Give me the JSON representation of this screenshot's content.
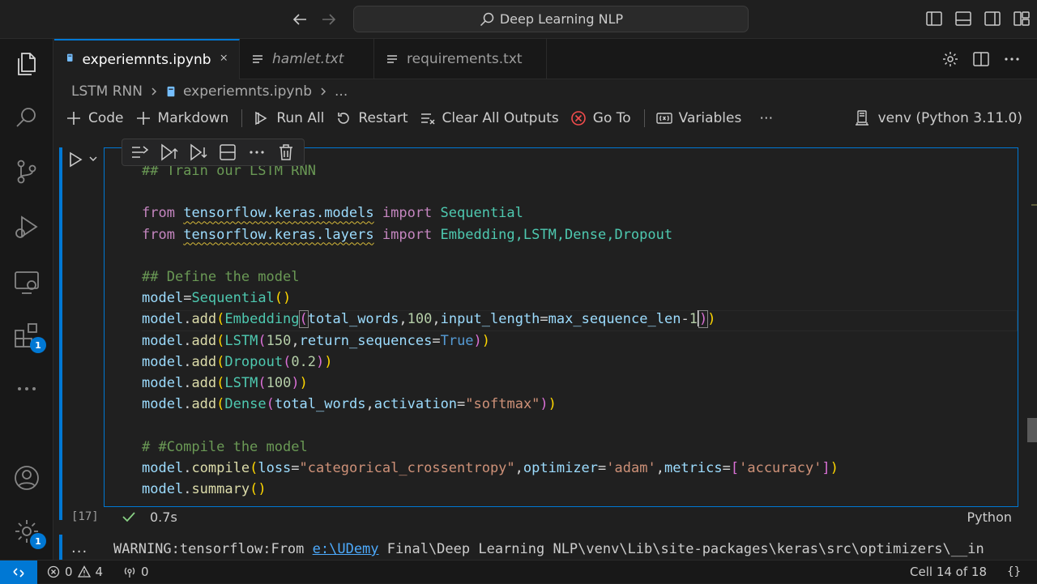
{
  "title": {
    "search_text": "Deep Learning NLP"
  },
  "tabs": [
    {
      "label": "experiemnts.ipynb",
      "icon": "notebook-icon",
      "active": true
    },
    {
      "label": "hamlet.txt",
      "icon": "text-file-icon",
      "active": false
    },
    {
      "label": "requirements.txt",
      "icon": "text-file-icon",
      "active": false
    }
  ],
  "breadcrumb": {
    "folder": "LSTM RNN",
    "file": "experiemnts.ipynb",
    "more": "..."
  },
  "toolbar": {
    "code": "Code",
    "markdown": "Markdown",
    "run_all": "Run All",
    "restart": "Restart",
    "clear_outputs": "Clear All Outputs",
    "go_to": "Go To",
    "variables": "Variables",
    "more": "⋯",
    "kernel": "venv (Python 3.11.0)"
  },
  "cell": {
    "exec_count": "[17]",
    "duration": "0.7s",
    "language": "Python",
    "status_color": "#89d185"
  },
  "code": {
    "l1": "## Train our LSTM RNN",
    "l3_kw1": "from",
    "l3_mod": "tensorflow.keras.models",
    "l3_kw2": "import",
    "l3_name": "Sequential",
    "l4_kw1": "from",
    "l4_mod": "tensorflow.keras.layers",
    "l4_kw2": "import",
    "l4_names": "Embedding,LSTM,Dense,Dropout",
    "l6": "## Define the model",
    "l7_var": "model",
    "l7_eq": "=",
    "l7_cls": "Sequential",
    "l7_p": "()",
    "l8_a": "model",
    "l8_b": ".",
    "l8_c": "add",
    "l8_d": "(",
    "l8_e": "Embedding",
    "l8_f": "(",
    "l8_g": "total_words",
    "l8_h": ",",
    "l8_i": "100",
    "l8_j": ",",
    "l8_k": "input_length",
    "l8_l": "=",
    "l8_m": "max_sequence_len",
    "l8_n": "-",
    "l8_o": "1",
    "l8_q": ")",
    "l9_a": "model",
    "l9_c": "add",
    "l9_e": "LSTM",
    "l9_i": "150",
    "l9_k": "return_sequences",
    "l9_m": "True",
    "l10_a": "model",
    "l10_c": "add",
    "l10_e": "Dropout",
    "l10_i": "0.2",
    "l11_a": "model",
    "l11_c": "add",
    "l11_e": "LSTM",
    "l11_i": "100",
    "l12_a": "model",
    "l12_c": "add",
    "l12_e": "Dense",
    "l12_g": "total_words",
    "l12_k": "activation",
    "l12_s": "\"softmax\"",
    "l14": "# #Compile the model",
    "l15_a": "model",
    "l15_c": "compile",
    "l15_k1": "loss",
    "l15_s1": "\"categorical_crossentropy\"",
    "l15_k2": "optimizer",
    "l15_s2": "'adam'",
    "l15_k3": "metrics",
    "l15_s3": "'accuracy'",
    "l16_a": "model",
    "l16_c": "summary"
  },
  "output": {
    "prefix": "WARNING:tensorflow:From ",
    "link": "e:\\UDemy",
    "rest": " Final\\Deep Learning NLP\\venv\\Lib\\site-packages\\keras\\src\\optimizers\\__in",
    "dots": "..."
  },
  "activity": {
    "extensions_badge": "1",
    "settings_badge": "1"
  },
  "status": {
    "errors": "0",
    "warnings": "4",
    "ports": "0",
    "cell_position": "Cell 14 of 18"
  }
}
